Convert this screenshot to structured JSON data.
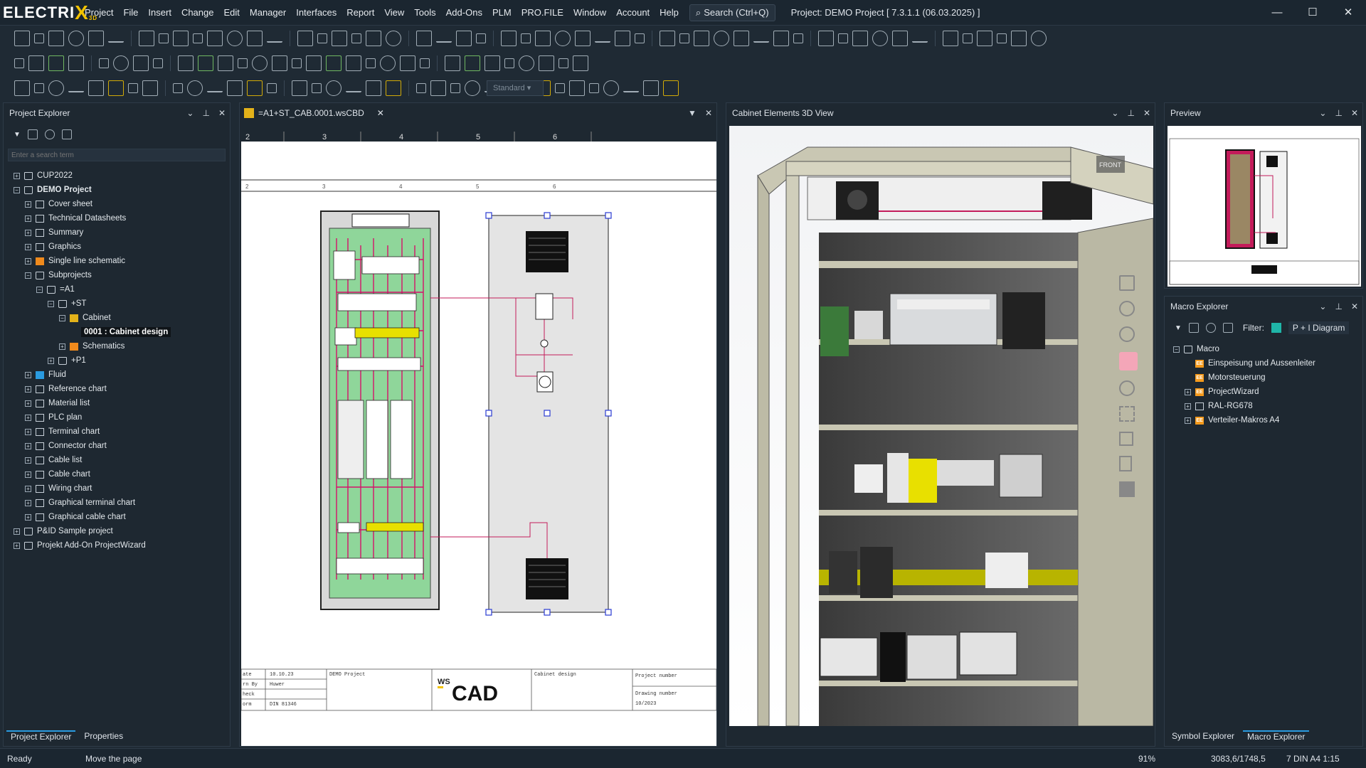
{
  "app": {
    "logo": "ELECTRI",
    "logo_x": "X",
    "logo_sub": "3D",
    "title": "Project: DEMO Project [ 7.3.1.1 (06.03.2025) ]",
    "menus": [
      "Project",
      "File",
      "Insert",
      "Change",
      "Edit",
      "Manager",
      "Interfaces",
      "Report",
      "View",
      "Tools",
      "Add-Ons",
      "PLM",
      "PRO.FILE",
      "Window",
      "Account",
      "Help"
    ],
    "search_label": "Search (Ctrl+Q)",
    "win_buttons": [
      "—",
      "☐",
      "✕"
    ]
  },
  "toolbar": {
    "style_select": "Standard"
  },
  "project_explorer": {
    "title": "Project Explorer",
    "search_placeholder": "Enter a search term",
    "tree": [
      {
        "label": "CUP2022",
        "depth": 0,
        "exp": "+",
        "icon": "folder"
      },
      {
        "label": "DEMO Project",
        "depth": 0,
        "exp": "−",
        "icon": "folder",
        "bold": true
      },
      {
        "label": "Cover sheet",
        "depth": 1,
        "exp": "+",
        "icon": "page"
      },
      {
        "label": "Technical Datasheets",
        "depth": 1,
        "exp": "+",
        "icon": "page"
      },
      {
        "label": "Summary",
        "depth": 1,
        "exp": "+",
        "icon": "page"
      },
      {
        "label": "Graphics",
        "depth": 1,
        "exp": "+",
        "icon": "page"
      },
      {
        "label": "Single line schematic",
        "depth": 1,
        "exp": "+",
        "icon": "orange"
      },
      {
        "label": "Subprojects",
        "depth": 1,
        "exp": "−",
        "icon": "folder"
      },
      {
        "label": "=A1",
        "depth": 2,
        "exp": "−",
        "icon": "folder"
      },
      {
        "label": "+ST",
        "depth": 3,
        "exp": "−",
        "icon": "folder"
      },
      {
        "label": "Cabinet",
        "depth": 4,
        "exp": "−",
        "icon": "yellow"
      },
      {
        "label": "0001 : Cabinet design",
        "depth": 5,
        "exp": "",
        "icon": "",
        "selected": true
      },
      {
        "label": "Schematics",
        "depth": 4,
        "exp": "+",
        "icon": "orange"
      },
      {
        "label": "+P1",
        "depth": 3,
        "exp": "+",
        "icon": "folder"
      },
      {
        "label": "Fluid",
        "depth": 1,
        "exp": "+",
        "icon": "blue"
      },
      {
        "label": "Reference chart",
        "depth": 1,
        "exp": "+",
        "icon": "page"
      },
      {
        "label": "Material list",
        "depth": 1,
        "exp": "+",
        "icon": "page"
      },
      {
        "label": "PLC plan",
        "depth": 1,
        "exp": "+",
        "icon": "page"
      },
      {
        "label": "Terminal chart",
        "depth": 1,
        "exp": "+",
        "icon": "page"
      },
      {
        "label": "Connector chart",
        "depth": 1,
        "exp": "+",
        "icon": "page"
      },
      {
        "label": "Cable list",
        "depth": 1,
        "exp": "+",
        "icon": "page"
      },
      {
        "label": "Cable chart",
        "depth": 1,
        "exp": "+",
        "icon": "page"
      },
      {
        "label": "Wiring chart",
        "depth": 1,
        "exp": "+",
        "icon": "page"
      },
      {
        "label": "Graphical terminal chart",
        "depth": 1,
        "exp": "+",
        "icon": "page"
      },
      {
        "label": "Graphical cable chart",
        "depth": 1,
        "exp": "+",
        "icon": "page"
      },
      {
        "label": "P&ID Sample project",
        "depth": 0,
        "exp": "+",
        "icon": "folder"
      },
      {
        "label": "Projekt Add-On ProjectWizard",
        "depth": 0,
        "exp": "+",
        "icon": "folder"
      }
    ],
    "bottom_tabs": [
      "Project Explorer",
      "Properties"
    ]
  },
  "document": {
    "tab": "=A1+ST_CAB.0001.wsCBD",
    "ruler": [
      "2",
      "3",
      "4",
      "5",
      "6"
    ],
    "titleblock": {
      "r1": "ate",
      "r1v": "10.10.23",
      "r2": "rn By",
      "r2v": "Huwer",
      "r3": "heck",
      "r4": "orm",
      "r4v": "DIN 81346",
      "project": "DEMO Project",
      "logo": "CAD",
      "logo_ws": "WS",
      "design": "Cabinet design",
      "proj_num": "Project number",
      "draw_num": "Drawing number",
      "draw_val": "10/2023"
    }
  },
  "view3d": {
    "title": "Cabinet Elements 3D View",
    "cube": "FRONT"
  },
  "preview": {
    "title": "Preview"
  },
  "macro": {
    "title": "Macro Explorer",
    "filter_label": "Filter:",
    "filter_value": "P + I Diagram",
    "tree": [
      {
        "label": "Macro",
        "depth": 0,
        "exp": "−",
        "icon": "folder"
      },
      {
        "label": "Einspeisung und Aussenleiter",
        "depth": 1,
        "exp": "",
        "icon": "ee"
      },
      {
        "label": "Motorsteuerung",
        "depth": 1,
        "exp": "",
        "icon": "ee"
      },
      {
        "label": "ProjectWizard",
        "depth": 1,
        "exp": "+",
        "icon": "ee"
      },
      {
        "label": "RAL-RG678",
        "depth": 1,
        "exp": "+",
        "icon": "house"
      },
      {
        "label": "Verteiler-Makros A4",
        "depth": 1,
        "exp": "+",
        "icon": "ee"
      }
    ],
    "bottom_tabs": [
      "Symbol Explorer",
      "Macro Explorer"
    ]
  },
  "status": {
    "ready": "Ready",
    "hint": "Move the page",
    "zoom": "91%",
    "coords": "3083,6/1748,5",
    "page": "7 DIN A4 1:15"
  }
}
